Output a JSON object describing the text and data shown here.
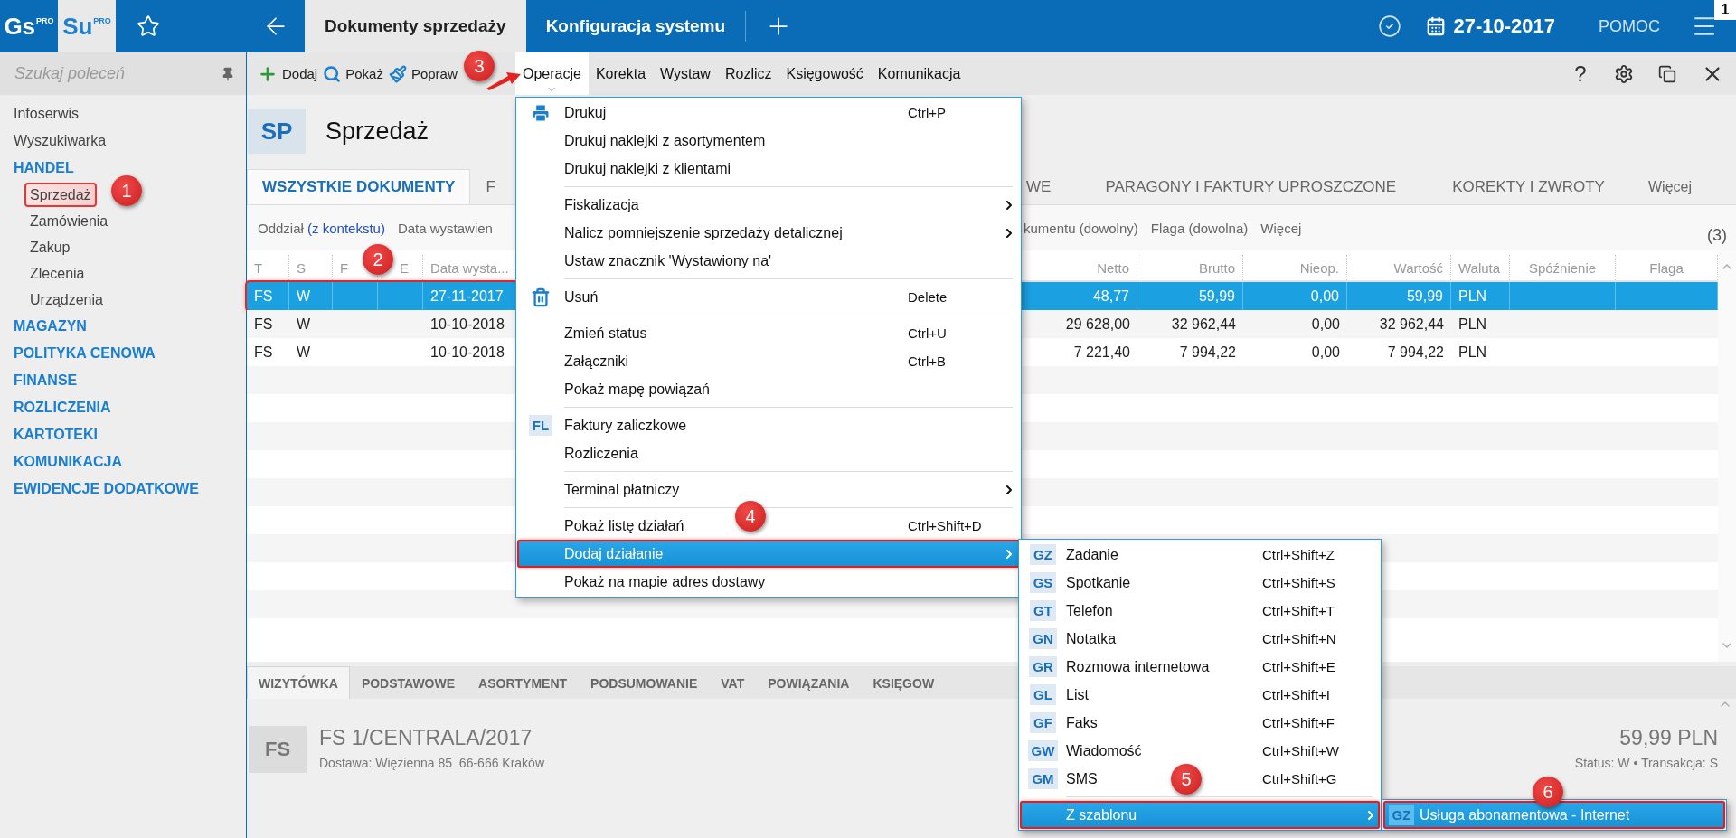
{
  "app_bar": {
    "logos": [
      {
        "label": "Gs",
        "tag": "PRO",
        "selected": false
      },
      {
        "label": "Su",
        "tag": "PRO",
        "selected": true
      }
    ],
    "tabs": [
      {
        "label": "Dokumenty sprzedaży",
        "selected": true
      },
      {
        "label": "Konfiguracja systemu",
        "selected": false
      }
    ],
    "date": "27-10-2017",
    "help": "POMOC",
    "notification_count": "1"
  },
  "sidebar": {
    "search": {
      "placeholder": "Szukaj poleceń"
    },
    "items": [
      {
        "label": "Infoserwis",
        "kind": "link"
      },
      {
        "label": "Wyszukiwarka",
        "kind": "link"
      },
      {
        "label": "HANDEL",
        "kind": "section",
        "children": [
          {
            "label": "Sprzedaż",
            "highlighted": true
          },
          {
            "label": "Zamówienia",
            "highlighted": false
          },
          {
            "label": "Zakup",
            "highlighted": false
          },
          {
            "label": "Zlecenia",
            "highlighted": false
          },
          {
            "label": "Urządzenia",
            "highlighted": false
          }
        ]
      },
      {
        "label": "MAGAZYN",
        "kind": "section"
      },
      {
        "label": "POLITYKA CENOWA",
        "kind": "section"
      },
      {
        "label": "FINANSE",
        "kind": "section"
      },
      {
        "label": "ROZLICZENIA",
        "kind": "section"
      },
      {
        "label": "KARTOTEKI",
        "kind": "section"
      },
      {
        "label": "KOMUNIKACJA",
        "kind": "section"
      },
      {
        "label": "EWIDENCJE DODATKOWE",
        "kind": "section"
      }
    ]
  },
  "toolbar": {
    "actions": [
      {
        "label": "Dodaj"
      },
      {
        "label": "Pokaż"
      },
      {
        "label": "Popraw"
      }
    ],
    "menus": [
      {
        "label": "Operacje",
        "selected": true
      },
      {
        "label": "Korekta",
        "selected": false
      },
      {
        "label": "Wystaw",
        "selected": false
      },
      {
        "label": "Rozlicz",
        "selected": false
      },
      {
        "label": "Księgowość",
        "selected": false
      },
      {
        "label": "Komunikacja",
        "selected": false
      }
    ],
    "help": "?"
  },
  "document": {
    "code": "SP",
    "title": "Sprzedaż",
    "tabs": [
      {
        "label": "WSZYSTKIE DOKUMENTY",
        "selected": true,
        "kind": "full"
      },
      {
        "label": "F",
        "selected": false,
        "kind": "cut-right"
      },
      {
        "label": "WE",
        "selected": false,
        "kind": "cut-left"
      },
      {
        "label": "PARAGONY I FAKTURY UPROSZCZONE",
        "selected": false,
        "kind": "full"
      },
      {
        "label": "KOREKTY I ZWROTY",
        "selected": false,
        "kind": "full"
      },
      {
        "label": "Więcej",
        "selected": false,
        "kind": "more"
      }
    ],
    "filters": [
      {
        "label": "Oddział",
        "value": "(z kontekstu)",
        "kind": "full"
      },
      {
        "label": "Data wystawien",
        "kind": "cut-right"
      },
      {
        "label": "kumentu (dowolny)",
        "kind": "cut-left"
      },
      {
        "label": "Flaga (dowolna)",
        "kind": "full"
      },
      {
        "label": "Więcej",
        "kind": "full"
      }
    ],
    "count": "(3)",
    "table": {
      "columns": [
        "T",
        "S",
        "F",
        "E",
        "Data wysta...",
        "Netto",
        "Brutto",
        "Nieop.",
        "Wartość",
        "Waluta",
        "Spóźnienie",
        "Flaga"
      ],
      "rows": [
        {
          "selected": true,
          "highlighted": true,
          "type": "FS",
          "status": "W",
          "issue_date": "27-11-2017",
          "net": "48,77",
          "gross": "59,99",
          "unpaid": "0,00",
          "value": "59,99",
          "currency": "PLN"
        },
        {
          "selected": false,
          "highlighted": false,
          "type": "FS",
          "status": "W",
          "issue_date": "10-10-2018",
          "net": "29 628,00",
          "gross": "32 962,44",
          "unpaid": "0,00",
          "value": "32 962,44",
          "currency": "PLN"
        },
        {
          "selected": false,
          "highlighted": false,
          "type": "FS",
          "status": "W",
          "issue_date": "10-10-2018",
          "net": "7 221,40",
          "gross": "7 994,22",
          "unpaid": "0,00",
          "value": "7 994,22",
          "currency": "PLN"
        }
      ]
    }
  },
  "detail": {
    "tabs": [
      {
        "label": "WIZYTÓWKA",
        "selected": true
      },
      {
        "label": "PODSTAWOWE",
        "selected": false
      },
      {
        "label": "ASORTYMENT",
        "selected": false
      },
      {
        "label": "PODSUMOWANIE",
        "selected": false
      },
      {
        "label": "VAT",
        "selected": false
      },
      {
        "label": "POWIĄZANIA",
        "selected": false
      },
      {
        "label": "KSIĘGOW",
        "selected": false
      }
    ],
    "code": "FS",
    "number": "FS 1/CENTRALA/2017",
    "address": "Dostawa: Więzienna 85  66-666 Kraków",
    "amount": "59,99 PLN",
    "status_line": "Status: W • Transakcja: S"
  },
  "operations_menu": {
    "groups": [
      [
        {
          "label": "Drukuj",
          "shortcut": "Ctrl+P",
          "kind": "print",
          "submenu": false,
          "selected": false,
          "highlighted": false
        },
        {
          "label": "Drukuj naklejki z asortymentem",
          "kind": "plain",
          "submenu": false,
          "selected": false,
          "highlighted": false
        },
        {
          "label": "Drukuj naklejki z klientami",
          "kind": "plain",
          "submenu": false,
          "selected": false,
          "highlighted": false
        }
      ],
      [
        {
          "label": "Fiskalizacja",
          "kind": "plain",
          "submenu": true,
          "selected": false,
          "highlighted": false
        },
        {
          "label": "Nalicz pomniejszenie sprzedaży detalicznej",
          "kind": "plain",
          "submenu": true,
          "selected": false,
          "highlighted": false
        },
        {
          "label": "Ustaw znacznik 'Wystawiony na'",
          "kind": "plain",
          "submenu": false,
          "selected": false,
          "highlighted": false
        }
      ],
      [
        {
          "label": "Usuń",
          "shortcut": "Delete",
          "kind": "delete",
          "submenu": false,
          "selected": false,
          "highlighted": false
        }
      ],
      [
        {
          "label": "Zmień status",
          "shortcut": "Ctrl+U",
          "kind": "plain",
          "submenu": false,
          "selected": false,
          "highlighted": false
        },
        {
          "label": "Załączniki",
          "shortcut": "Ctrl+B",
          "kind": "plain",
          "submenu": false,
          "selected": false,
          "highlighted": false
        },
        {
          "label": "Pokaż mapę powiązań",
          "kind": "plain",
          "submenu": false,
          "selected": false,
          "highlighted": false
        }
      ],
      [
        {
          "label": "Faktury zaliczkowe",
          "code": "FL",
          "kind": "code",
          "submenu": false,
          "selected": false,
          "highlighted": false
        },
        {
          "label": "Rozliczenia",
          "kind": "plain",
          "submenu": false,
          "selected": false,
          "highlighted": false
        }
      ],
      [
        {
          "label": "Terminal płatniczy",
          "kind": "plain",
          "submenu": true,
          "selected": false,
          "highlighted": false
        }
      ],
      [
        {
          "label": "Pokaż listę działań",
          "shortcut": "Ctrl+Shift+D",
          "kind": "plain",
          "submenu": false,
          "selected": false,
          "highlighted": false
        },
        {
          "label": "Dodaj działanie",
          "kind": "plain",
          "submenu": true,
          "selected": true,
          "highlighted": true
        },
        {
          "label": "Pokaż na mapie adres dostawy",
          "kind": "plain",
          "submenu": false,
          "selected": false,
          "highlighted": false
        }
      ]
    ]
  },
  "action_submenu": {
    "groups": [
      [
        {
          "label": "Zadanie",
          "code": "GZ",
          "shortcut": "Ctrl+Shift+Z",
          "kind": "code",
          "submenu": false,
          "selected": false,
          "highlighted": false
        },
        {
          "label": "Spotkanie",
          "code": "GS",
          "shortcut": "Ctrl+Shift+S",
          "kind": "code",
          "submenu": false,
          "selected": false,
          "highlighted": false
        },
        {
          "label": "Telefon",
          "code": "GT",
          "shortcut": "Ctrl+Shift+T",
          "kind": "code",
          "submenu": false,
          "selected": false,
          "highlighted": false
        },
        {
          "label": "Notatka",
          "code": "GN",
          "shortcut": "Ctrl+Shift+N",
          "kind": "code",
          "submenu": false,
          "selected": false,
          "highlighted": false
        },
        {
          "label": "Rozmowa internetowa",
          "code": "GR",
          "shortcut": "Ctrl+Shift+E",
          "kind": "code",
          "submenu": false,
          "selected": false,
          "highlighted": false
        },
        {
          "label": "List",
          "code": "GL",
          "shortcut": "Ctrl+Shift+I",
          "kind": "code",
          "submenu": false,
          "selected": false,
          "highlighted": false
        },
        {
          "label": "Faks",
          "code": "GF",
          "shortcut": "Ctrl+Shift+F",
          "kind": "code",
          "submenu": false,
          "selected": false,
          "highlighted": false
        },
        {
          "label": "Wiadomość",
          "code": "GW",
          "shortcut": "Ctrl+Shift+W",
          "kind": "code",
          "submenu": false,
          "selected": false,
          "highlighted": false
        },
        {
          "label": "SMS",
          "code": "GM",
          "shortcut": "Ctrl+Shift+G",
          "kind": "code",
          "submenu": false,
          "selected": false,
          "highlighted": false
        }
      ],
      [
        {
          "label": "Z szablonu",
          "kind": "plain",
          "submenu": true,
          "selected": true,
          "highlighted": true
        }
      ]
    ]
  },
  "template_submenu": {
    "groups": [
      [
        {
          "label": "Usługa abonamentowa - Internet",
          "code": "GZ",
          "kind": "code",
          "submenu": false,
          "selected": true,
          "highlighted": true
        }
      ]
    ]
  },
  "callouts": [
    {
      "number": "1"
    },
    {
      "number": "2"
    },
    {
      "number": "3"
    },
    {
      "number": "4"
    },
    {
      "number": "5"
    },
    {
      "number": "6"
    }
  ]
}
